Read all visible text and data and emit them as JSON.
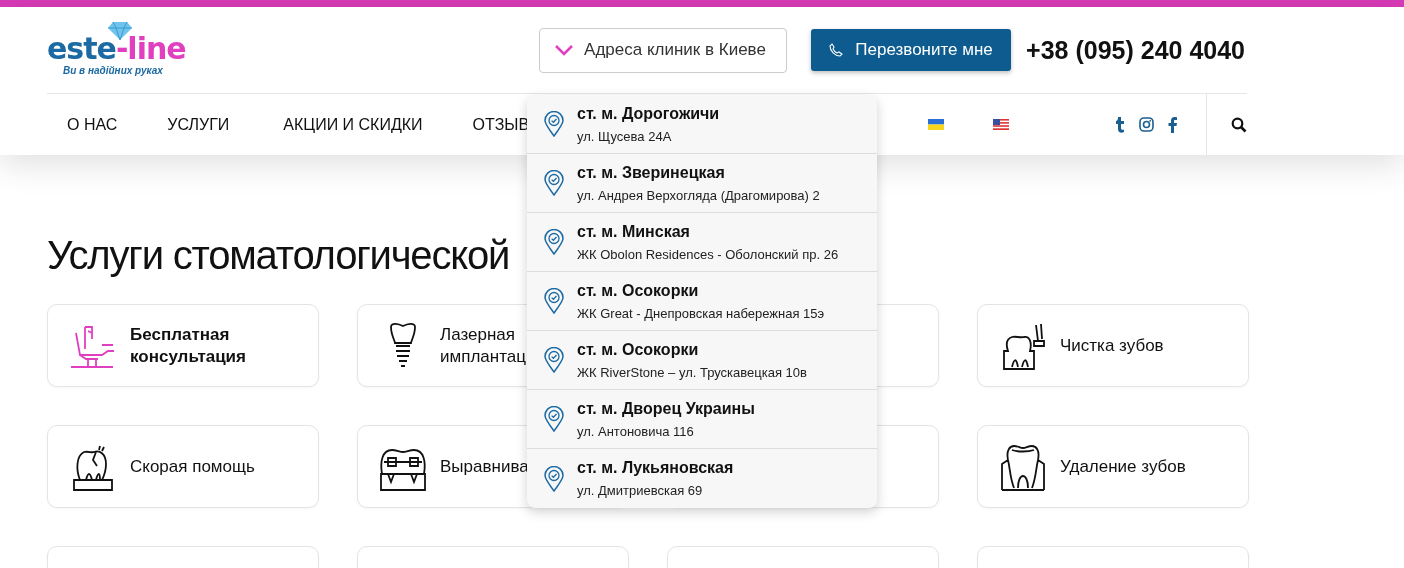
{
  "logo": {
    "name_parts": [
      "este",
      "-line"
    ],
    "slogan": "Ви в надійних руках"
  },
  "header": {
    "clinics_button": "Адреса клиник в Киеве",
    "call_button": "Перезвоните мне",
    "phone": "+38 (095) 240 4040"
  },
  "nav": {
    "items": [
      "О НАС",
      "УСЛУГИ",
      "АКЦИИ И СКИДКИ",
      "ОТЗЫВ"
    ]
  },
  "clinics_dropdown": [
    {
      "station": "ст. м. Дорогожичи",
      "address": "ул. Щусева 24А"
    },
    {
      "station": "ст. м. Зверинецкая",
      "address": "ул. Андрея Верхогляда (Драгомирова) 2"
    },
    {
      "station": "ст. м. Минская",
      "address": "ЖК Obolon Residences - Оболонский пр. 26"
    },
    {
      "station": "ст. м. Осокорки",
      "address": "ЖК Great - Днепровская набережная 15э"
    },
    {
      "station": "ст. м. Осокорки",
      "address": "ЖК RiverStone – ул. Трускавецкая 10в"
    },
    {
      "station": "ст. м. Дворец Украины",
      "address": "ул. Антоновича 116"
    },
    {
      "station": "ст. м. Лукьяновская",
      "address": "ул. Дмитриевская 69"
    }
  ],
  "heading": "Услуги стоматологической",
  "cards": [
    {
      "title": "Бесплатная консультация",
      "kind": "chair",
      "highlighted": true
    },
    {
      "title": "Лазерная имплантац",
      "kind": "implant",
      "highlighted": false
    },
    {
      "kind": "blank"
    },
    {
      "title": "Чистка зубов",
      "kind": "scaler",
      "highlighted": false
    },
    {
      "title": "Скорая помощь",
      "kind": "crack",
      "highlighted": false
    },
    {
      "title": "Выравнива",
      "kind": "braces",
      "highlighted": false
    },
    {
      "kind": "blank"
    },
    {
      "title": "Удаление зубов",
      "kind": "root",
      "highlighted": false
    },
    {
      "kind": "blank"
    },
    {
      "kind": "blank"
    },
    {
      "kind": "blank"
    },
    {
      "kind": "blank"
    }
  ]
}
